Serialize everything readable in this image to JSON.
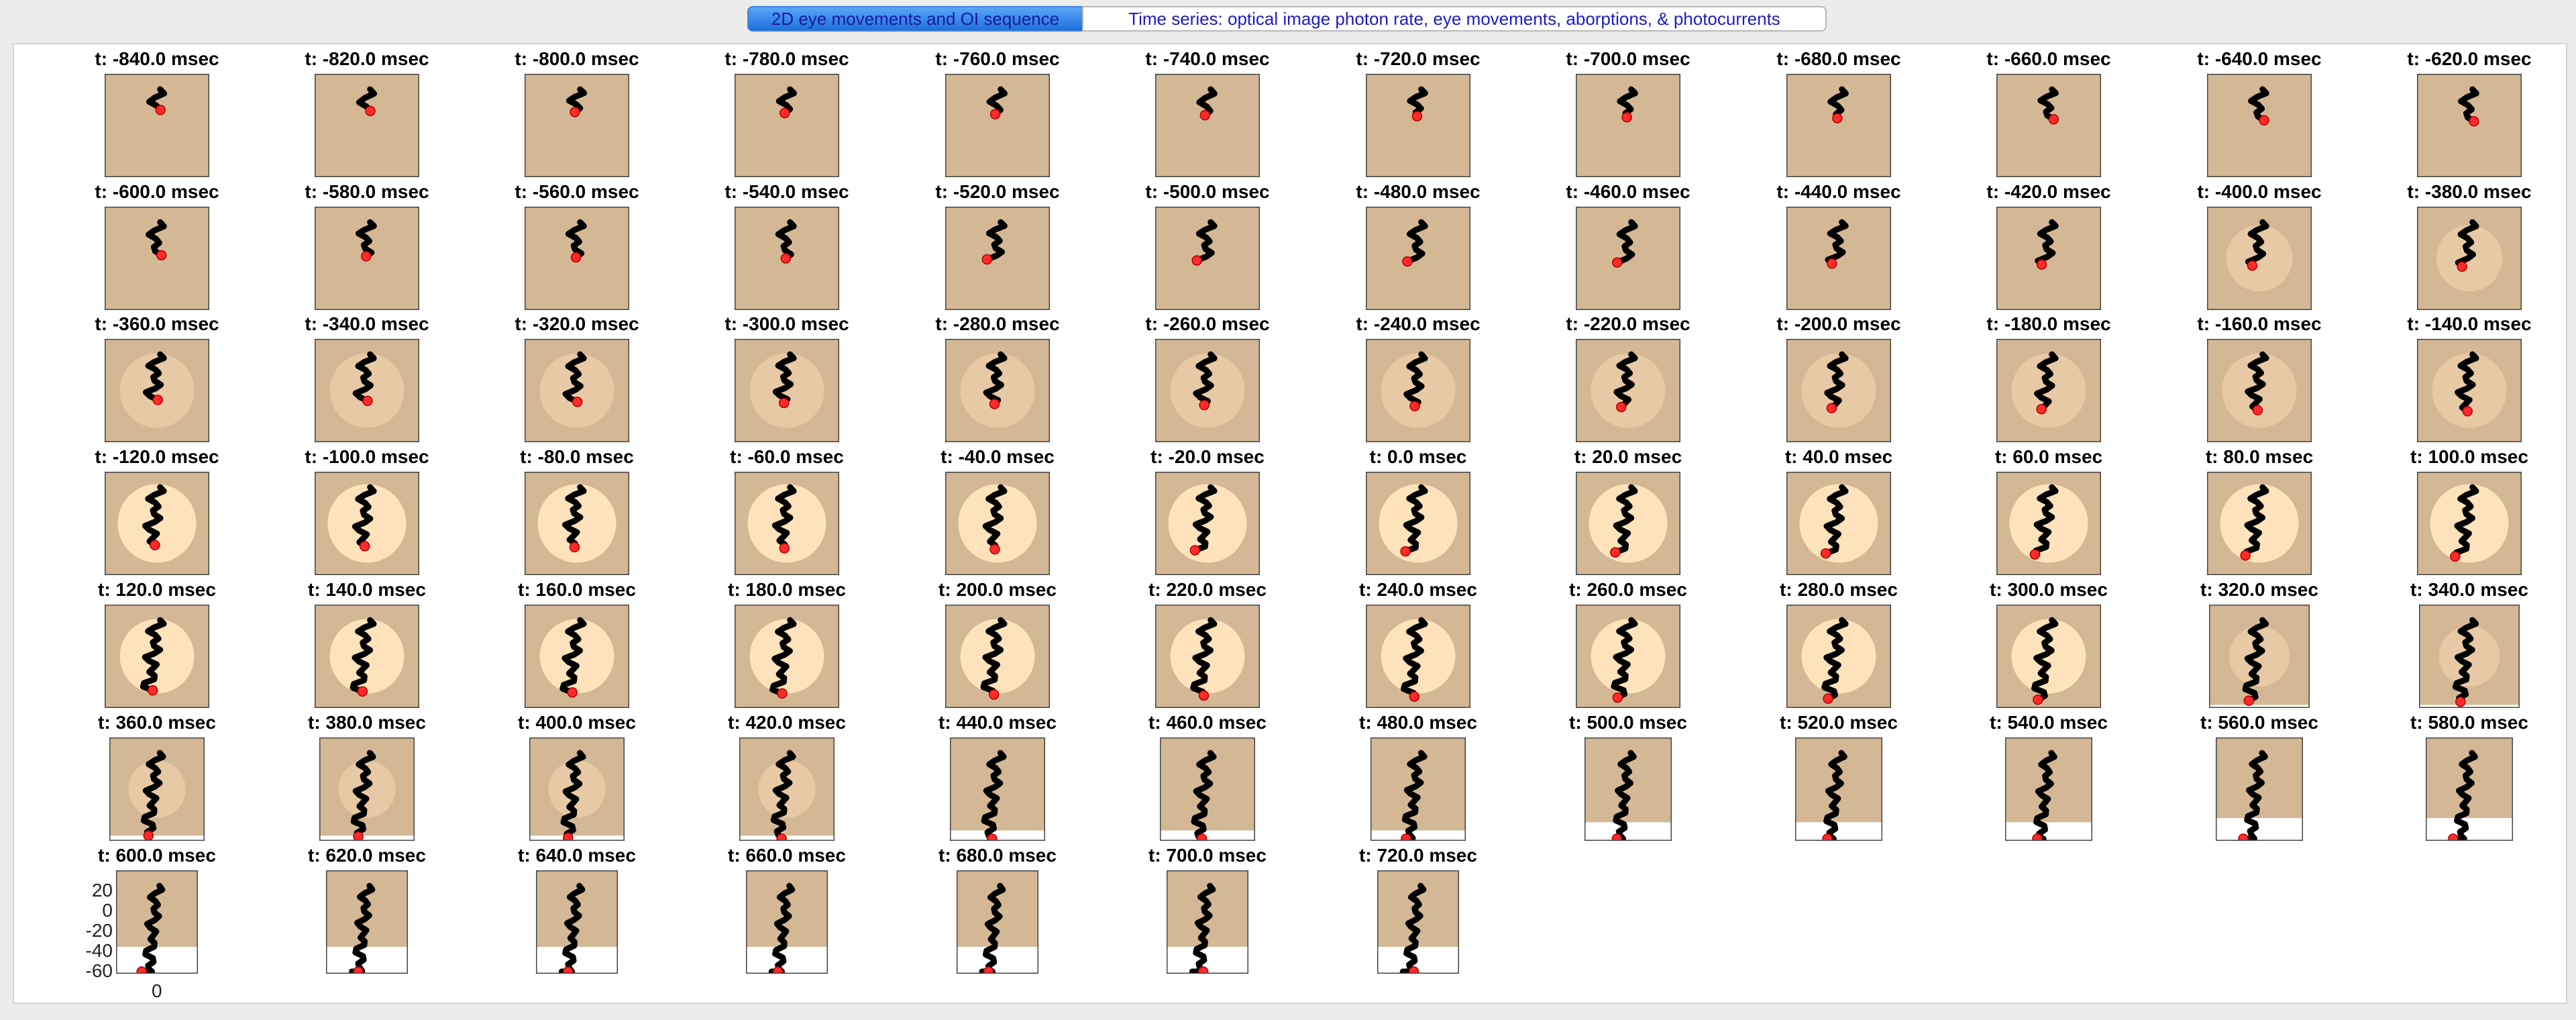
{
  "tabs": [
    {
      "label": "2D eye movements and OI sequence",
      "selected": true
    },
    {
      "label": "Time series: optical image photon rate, eye movements, aborptions, & photocurrents",
      "selected": false
    }
  ],
  "colors": {
    "stimulus_background": "#d4b896",
    "stimulus_spot_mid": "#e8c9a5",
    "stimulus_spot_bright": "#fde2bc",
    "eye_trace": "#000000",
    "current_position": "#ff2a2a",
    "tab_selected_top": "#5aa6f6",
    "tab_selected_bottom": "#1f6fe0"
  },
  "frames": [
    {
      "title": "t: -840.0 msec"
    },
    {
      "title": "t: -820.0 msec"
    },
    {
      "title": "t: -800.0 msec"
    },
    {
      "title": "t: -780.0 msec"
    },
    {
      "title": "t: -760.0 msec"
    },
    {
      "title": "t: -740.0 msec"
    },
    {
      "title": "t: -720.0 msec"
    },
    {
      "title": "t: -700.0 msec"
    },
    {
      "title": "t: -680.0 msec"
    },
    {
      "title": "t: -660.0 msec"
    },
    {
      "title": "t: -640.0 msec"
    },
    {
      "title": "t: -620.0 msec"
    },
    {
      "title": "t: -600.0 msec"
    },
    {
      "title": "t: -580.0 msec"
    },
    {
      "title": "t: -560.0 msec"
    },
    {
      "title": "t: -540.0 msec"
    },
    {
      "title": "t: -520.0 msec"
    },
    {
      "title": "t: -500.0 msec"
    },
    {
      "title": "t: -480.0 msec"
    },
    {
      "title": "t: -460.0 msec"
    },
    {
      "title": "t: -440.0 msec"
    },
    {
      "title": "t: -420.0 msec"
    },
    {
      "title": "t: -400.0 msec"
    },
    {
      "title": "t: -380.0 msec"
    },
    {
      "title": "t: -360.0 msec"
    },
    {
      "title": "t: -340.0 msec"
    },
    {
      "title": "t: -320.0 msec"
    },
    {
      "title": "t: -300.0 msec"
    },
    {
      "title": "t: -280.0 msec"
    },
    {
      "title": "t: -260.0 msec"
    },
    {
      "title": "t: -240.0 msec"
    },
    {
      "title": "t: -220.0 msec"
    },
    {
      "title": "t: -200.0 msec"
    },
    {
      "title": "t: -180.0 msec"
    },
    {
      "title": "t: -160.0 msec"
    },
    {
      "title": "t: -140.0 msec"
    },
    {
      "title": "t: -120.0 msec"
    },
    {
      "title": "t: -100.0 msec"
    },
    {
      "title": "t: -80.0 msec"
    },
    {
      "title": "t: -60.0 msec"
    },
    {
      "title": "t: -40.0 msec"
    },
    {
      "title": "t: -20.0 msec"
    },
    {
      "title": "t: 0.0 msec"
    },
    {
      "title": "t: 20.0 msec"
    },
    {
      "title": "t: 40.0 msec"
    },
    {
      "title": "t: 60.0 msec"
    },
    {
      "title": "t: 80.0 msec"
    },
    {
      "title": "t: 100.0 msec"
    },
    {
      "title": "t: 120.0 msec"
    },
    {
      "title": "t: 140.0 msec"
    },
    {
      "title": "t: 160.0 msec"
    },
    {
      "title": "t: 180.0 msec"
    },
    {
      "title": "t: 200.0 msec"
    },
    {
      "title": "t: 220.0 msec"
    },
    {
      "title": "t: 240.0 msec"
    },
    {
      "title": "t: 260.0 msec"
    },
    {
      "title": "t: 280.0 msec"
    },
    {
      "title": "t: 300.0 msec"
    },
    {
      "title": "t: 320.0 msec"
    },
    {
      "title": "t: 340.0 msec"
    },
    {
      "title": "t: 360.0 msec"
    },
    {
      "title": "t: 380.0 msec"
    },
    {
      "title": "t: 400.0 msec"
    },
    {
      "title": "t: 420.0 msec"
    },
    {
      "title": "t: 440.0 msec"
    },
    {
      "title": "t: 460.0 msec"
    },
    {
      "title": "t: 480.0 msec"
    },
    {
      "title": "t: 500.0 msec"
    },
    {
      "title": "t: 520.0 msec"
    },
    {
      "title": "t: 540.0 msec"
    },
    {
      "title": "t: 560.0 msec"
    },
    {
      "title": "t: 580.0 msec"
    },
    {
      "title": "t: 600.0 msec"
    },
    {
      "title": "t: 620.0 msec"
    },
    {
      "title": "t: 640.0 msec"
    },
    {
      "title": "t: 660.0 msec"
    },
    {
      "title": "t: 680.0 msec"
    },
    {
      "title": "t: 700.0 msec"
    },
    {
      "title": "t: 720.0 msec"
    }
  ],
  "axis_ticks": {
    "y": [
      "20",
      "0",
      "-20",
      "-40",
      "-60"
    ],
    "x": [
      "0"
    ]
  }
}
